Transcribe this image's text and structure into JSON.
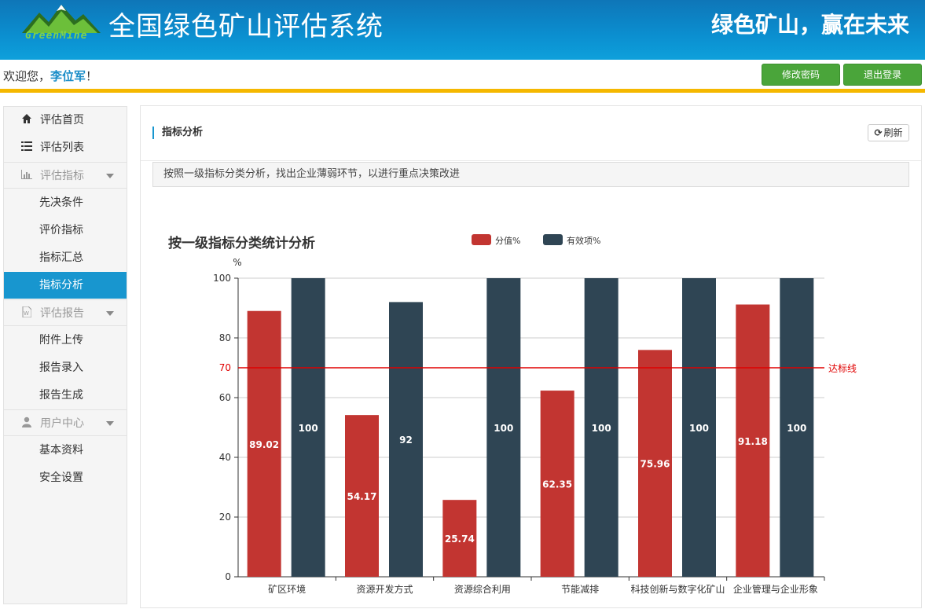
{
  "header": {
    "logo_text": "GreenMine",
    "title": "全国绿色矿山评估系统",
    "slogan": "绿色矿山，赢在未来"
  },
  "userbar": {
    "welcome_prefix": "欢迎您，",
    "user_name": "李位军",
    "welcome_suffix": "！",
    "change_password": "修改密码",
    "logout": "退出登录"
  },
  "sidebar": {
    "items": [
      {
        "label": "评估首页",
        "icon": "home-icon"
      },
      {
        "label": "评估列表",
        "icon": "list-icon"
      },
      {
        "label": "评估指标",
        "icon": "bar-chart-icon"
      },
      {
        "label": "先决条件"
      },
      {
        "label": "评价指标"
      },
      {
        "label": "指标汇总"
      },
      {
        "label": "指标分析"
      },
      {
        "label": "评估报告",
        "icon": "document-icon"
      },
      {
        "label": "附件上传"
      },
      {
        "label": "报告录入"
      },
      {
        "label": "报告生成"
      },
      {
        "label": "用户中心",
        "icon": "user-icon"
      },
      {
        "label": "基本资料"
      },
      {
        "label": "安全设置"
      }
    ]
  },
  "main": {
    "panel_title": "指标分析",
    "refresh_label": "刷新",
    "note": "按照一级指标分类分析，找出企业薄弱环节，以进行重点决策改进"
  },
  "chart_data": {
    "type": "bar",
    "title": "按一级指标分类统计分析",
    "ylabel": "%",
    "ylim": [
      0,
      100
    ],
    "yticks": [
      0,
      20,
      40,
      60,
      80,
      100
    ],
    "categories": [
      "矿区环境",
      "资源开发方式",
      "资源综合利用",
      "节能减排",
      "科技创新与数字化矿山",
      "企业管理与企业形象"
    ],
    "series": [
      {
        "name": "分值%",
        "color": "#c23531",
        "values": [
          89.02,
          54.17,
          25.74,
          62.35,
          75.96,
          91.18
        ]
      },
      {
        "name": "有效项%",
        "color": "#2f4554",
        "values": [
          100,
          92,
          100,
          100,
          100,
          100
        ]
      }
    ],
    "markline": {
      "value": 70,
      "label": "达标线",
      "color": "#e00000"
    },
    "legend_position": "top-center",
    "grid": true
  }
}
